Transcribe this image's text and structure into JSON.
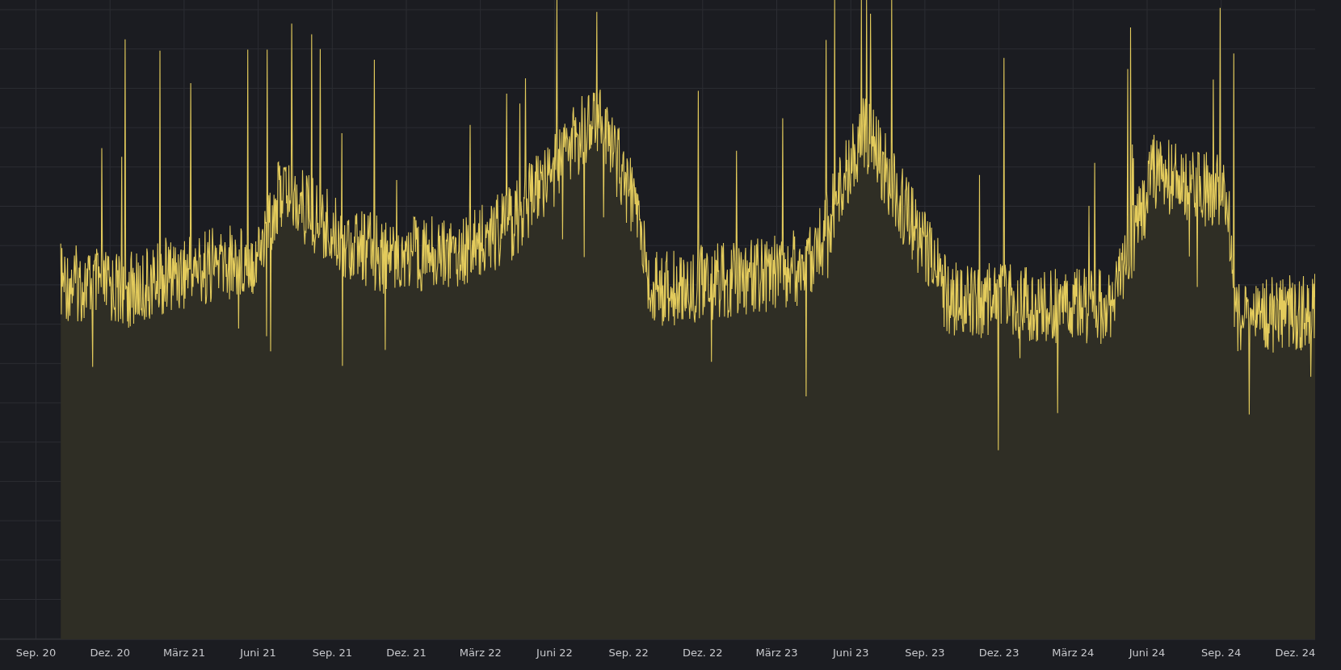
{
  "chart": {
    "x_axis_ticks": [
      "Sep. 20",
      "Dez. 20",
      "März 21",
      "Juni 21",
      "Sep. 21",
      "Dez. 21",
      "März 22",
      "Juni 22",
      "Sep. 22",
      "Dez. 22",
      "März 23",
      "Juni 23",
      "Sep. 23",
      "Dez. 23",
      "März 24",
      "Juni 24",
      "Sep. 24",
      "Dez. 24"
    ]
  }
}
